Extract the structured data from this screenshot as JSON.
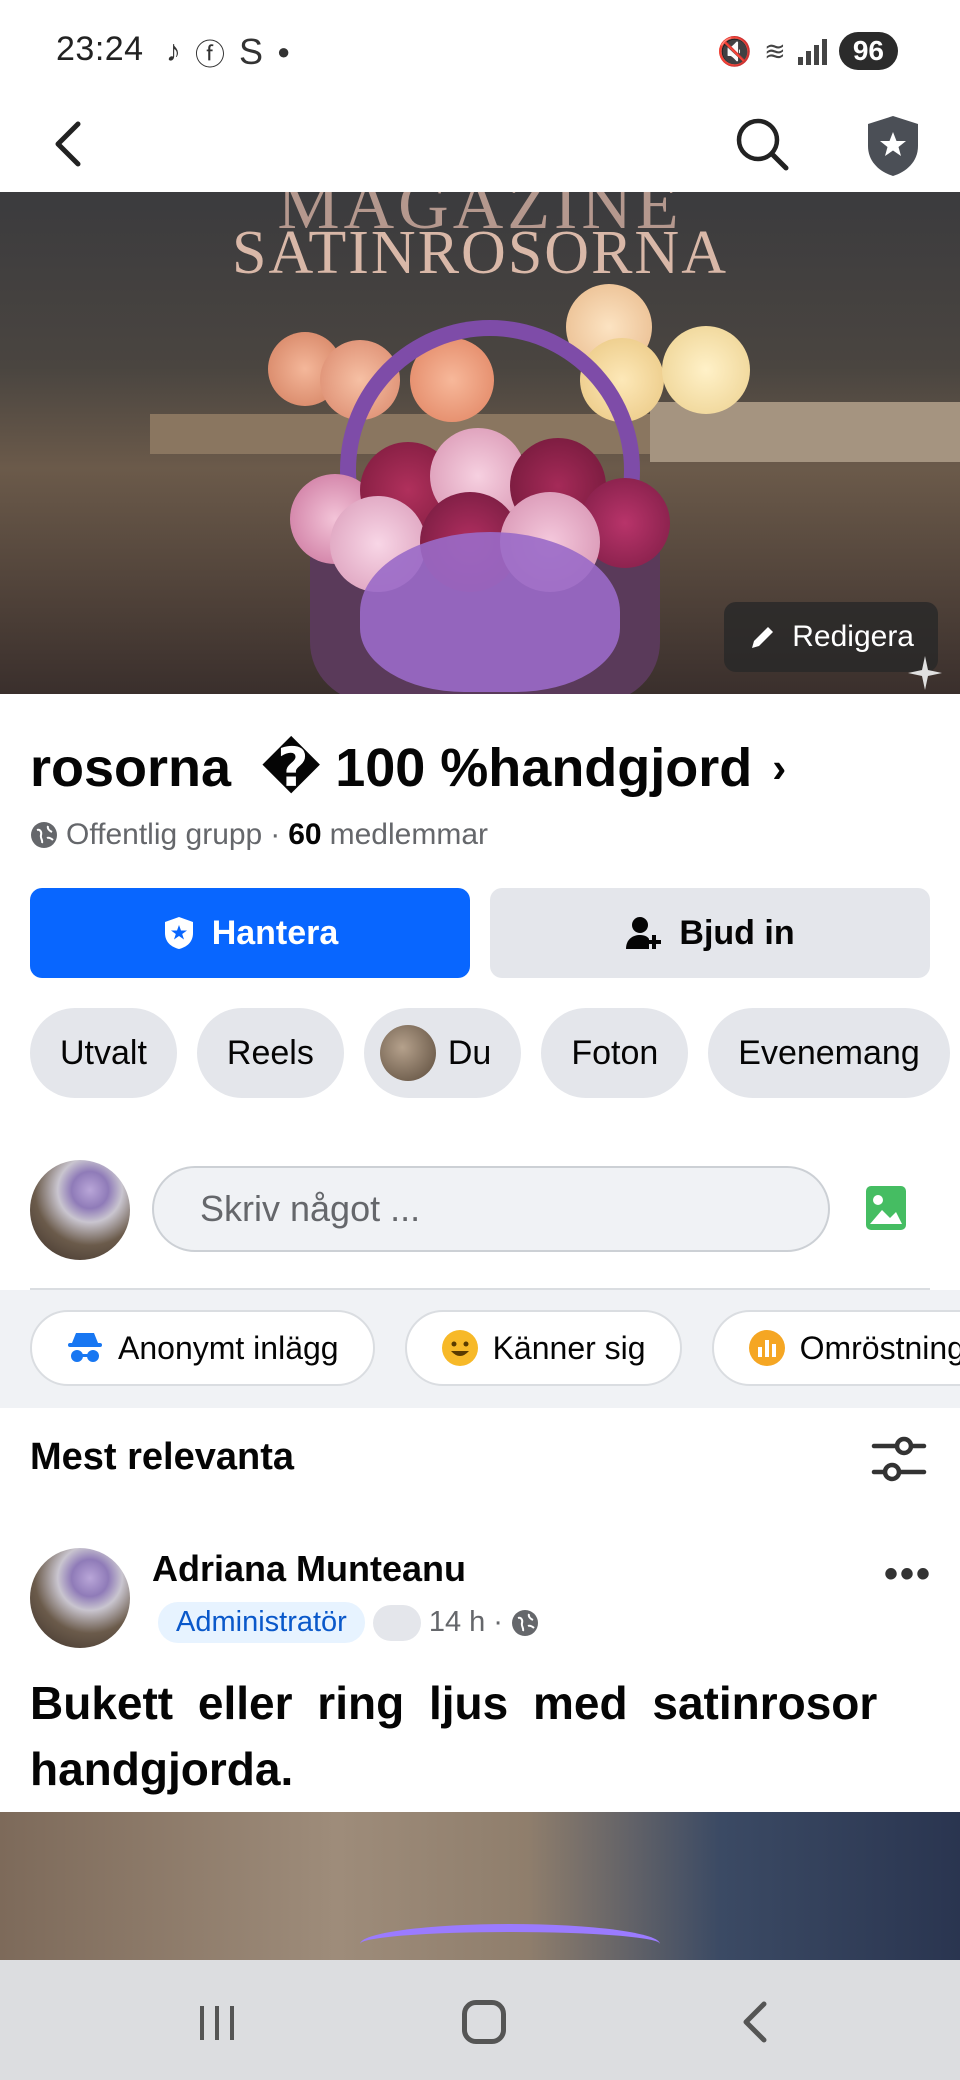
{
  "status": {
    "time": "23:24",
    "notif_icons": [
      "tiktok-icon",
      "facebook-icon",
      "s-icon",
      "dot-icon"
    ],
    "battery": "96"
  },
  "nav": {
    "back": "back-icon",
    "search": "search-icon",
    "admin": "admin-shield-icon"
  },
  "cover": {
    "title_top": "MAGAZINE",
    "title": "SATINROSORNA",
    "edit_label": "Redigera"
  },
  "group": {
    "name_part1": "rosorna",
    "name_symbol": "�",
    "name_part2": "100 %handgjord",
    "visibility": "Offentlig grupp",
    "separator": "·",
    "member_count": "60",
    "members_label": "medlemmar"
  },
  "actions": {
    "manage_label": "Hantera",
    "invite_label": "Bjud in"
  },
  "tabs": [
    {
      "label": "Utvalt"
    },
    {
      "label": "Reels"
    },
    {
      "label": "Du"
    },
    {
      "label": "Foton"
    },
    {
      "label": "Evenemang"
    }
  ],
  "composer": {
    "placeholder": "Skriv något ..."
  },
  "post_options": [
    {
      "label": "Anonymt inlägg",
      "color": "#1877f2"
    },
    {
      "label": "Känner sig",
      "color": "#f7b928"
    },
    {
      "label": "Omröstning",
      "color": "#f5a623"
    }
  ],
  "feed": {
    "sort_label": "Mest relevanta"
  },
  "post": {
    "author": "Adriana Munteanu",
    "role": "Administratör",
    "time": "14 h",
    "dot": "·",
    "text": "Bukett eller ring ljus med satinrosor handgjorda."
  },
  "colors": {
    "primary": "#0866ff",
    "secondary_bg": "#e4e6eb",
    "text": "#050505",
    "muted": "#65676b"
  }
}
